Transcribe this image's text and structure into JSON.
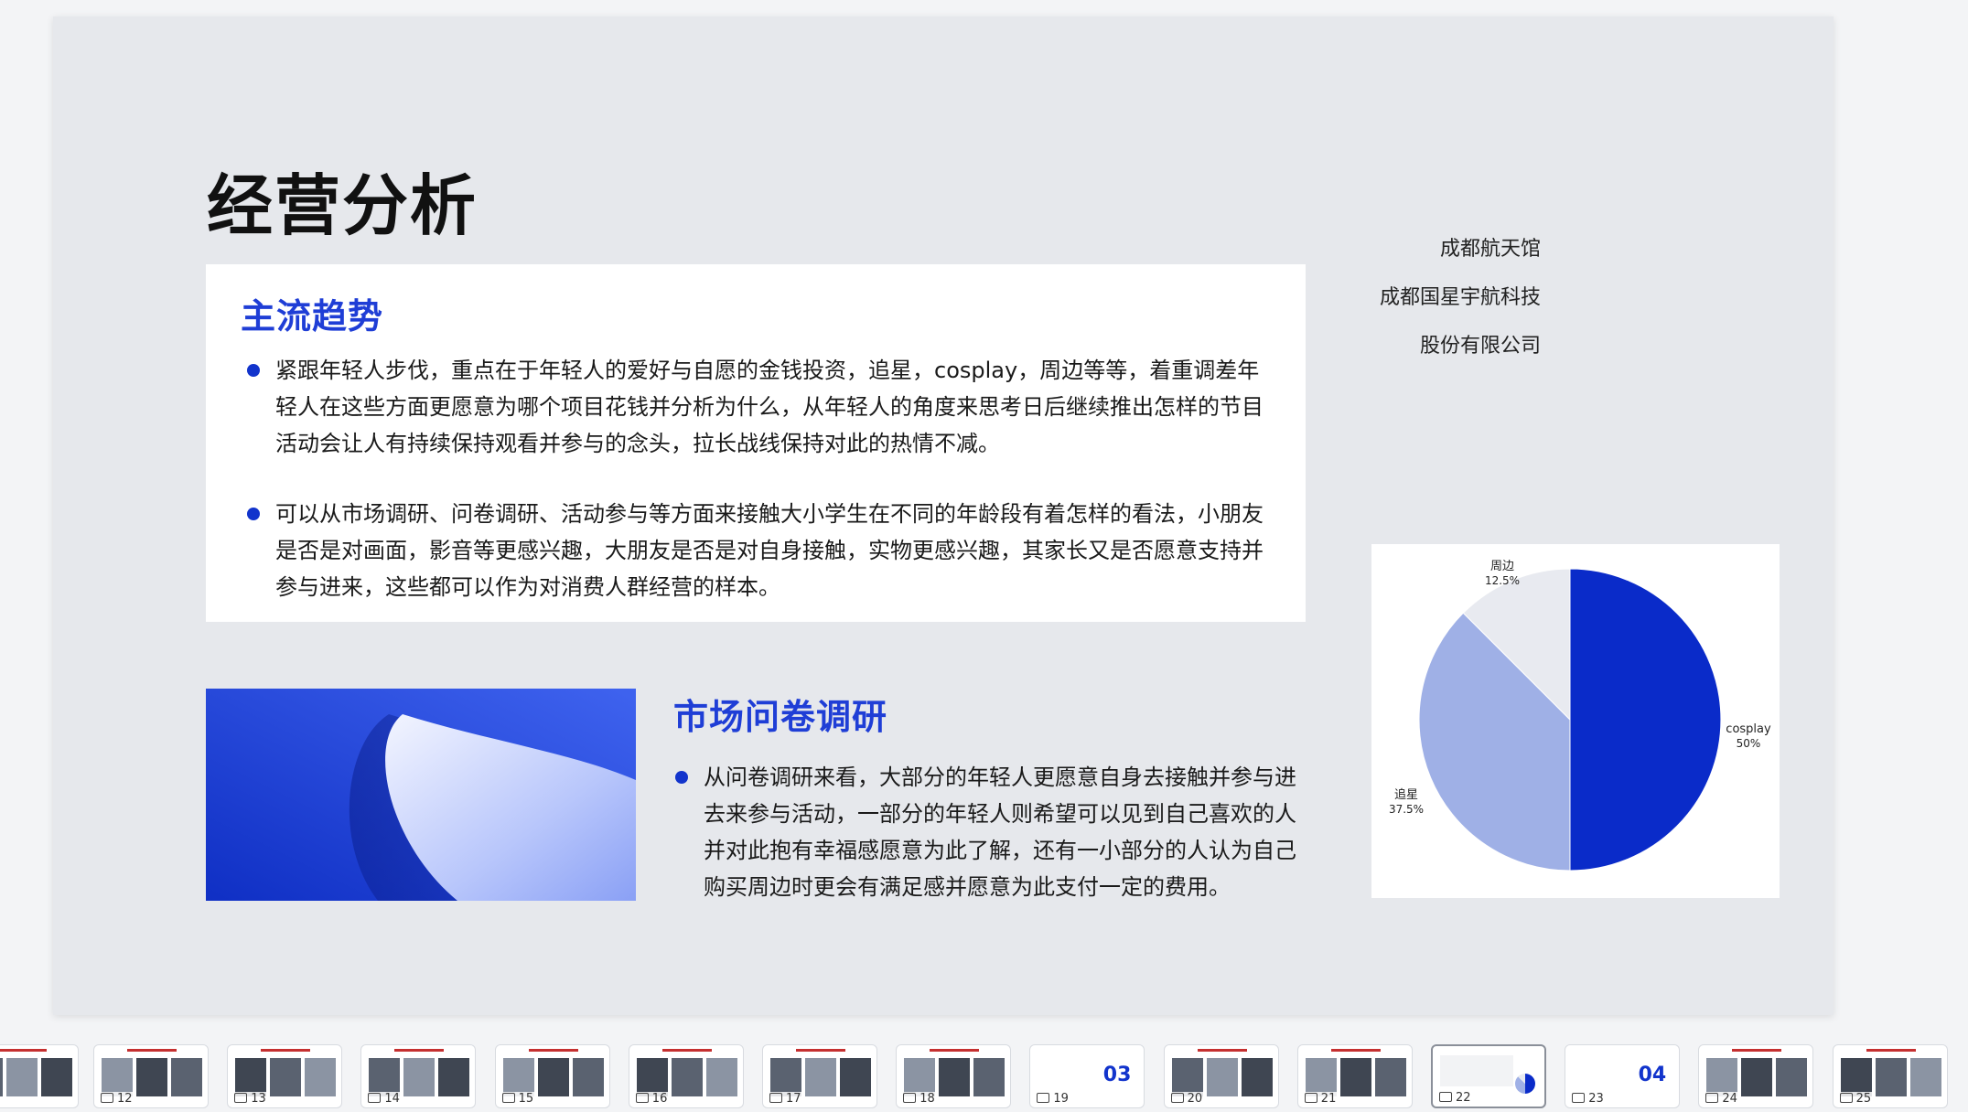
{
  "slide": {
    "title": "经营分析",
    "company_lines": [
      "成都航天馆",
      "成都国星宇航科技",
      "股份有限公司"
    ],
    "trend": {
      "heading": "主流趋势",
      "bullets": [
        "紧跟年轻人步伐，重点在于年轻人的爱好与自愿的金钱投资，追星，cosplay，周边等等，着重调差年轻人在这些方面更愿意为哪个项目花钱并分析为什么，从年轻人的角度来思考日后继续推出怎样的节目活动会让人有持续保持观看并参与的念头，拉长战线保持对此的热情不减。",
        "可以从市场调研、问卷调研、活动参与等方面来接触大小学生在不同的年龄段有着怎样的看法，小朋友是否是对画面，影音等更感兴趣，大朋友是否是对自身接触，实物更感兴趣，其家长又是否愿意支持并参与进来，这些都可以作为对消费人群经营的样本。"
      ]
    },
    "survey": {
      "heading": "市场问卷调研",
      "bullet": "从问卷调研来看，大部分的年轻人更愿意自身去接触并参与进去来参与活动，一部分的年轻人则希望可以见到自己喜欢的人并对此抱有幸福感愿意为此了解，还有一小部分的人认为自己购买周边时更会有满足感并愿意为此支付一定的费用。"
    }
  },
  "chart_data": {
    "type": "pie",
    "slices": [
      {
        "label": "cosplay",
        "value": 50,
        "value_label": "50%",
        "color": "#0a2bc9"
      },
      {
        "label": "追星",
        "value": 37.5,
        "value_label": "37.5%",
        "color": "#9fb0e6"
      },
      {
        "label": "周边",
        "value": 12.5,
        "value_label": "12.5%",
        "color": "#e8eaf0"
      }
    ]
  },
  "thumbnails": [
    {
      "number": "",
      "kind": "images"
    },
    {
      "number": "12",
      "kind": "images"
    },
    {
      "number": "13",
      "kind": "images"
    },
    {
      "number": "14",
      "kind": "images"
    },
    {
      "number": "15",
      "kind": "images"
    },
    {
      "number": "16",
      "kind": "images"
    },
    {
      "number": "17",
      "kind": "images"
    },
    {
      "number": "18",
      "kind": "images"
    },
    {
      "number": "19",
      "kind": "section",
      "section_no": "03"
    },
    {
      "number": "20",
      "kind": "images"
    },
    {
      "number": "21",
      "kind": "images"
    },
    {
      "number": "22",
      "kind": "current"
    },
    {
      "number": "23",
      "kind": "section",
      "section_no": "04"
    },
    {
      "number": "24",
      "kind": "images"
    },
    {
      "number": "25",
      "kind": "images"
    }
  ],
  "colors": {
    "accent": "#1f3ed6",
    "bullet": "#1234cc",
    "pie_primary": "#0a2bc9",
    "pie_secondary": "#9fb0e6",
    "pie_tertiary": "#e8eaf0"
  }
}
